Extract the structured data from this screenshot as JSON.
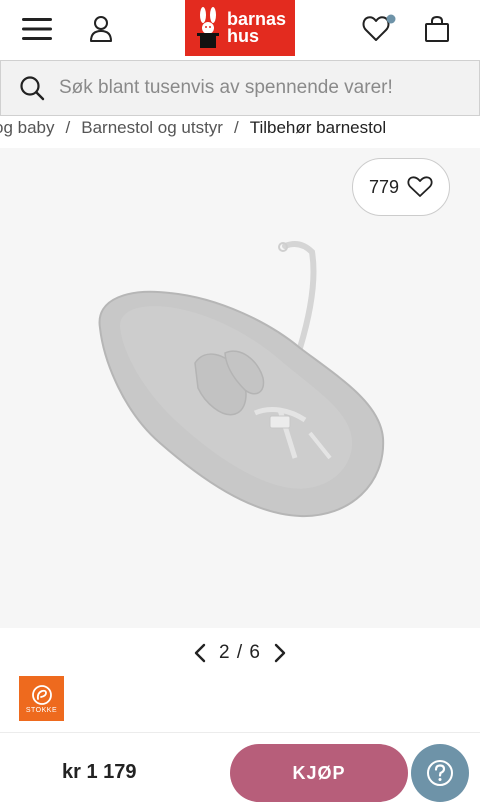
{
  "header": {
    "logo_line1": "barnas",
    "logo_line2": "hus",
    "brand_color": "#e32b1f",
    "icons": [
      "menu-icon",
      "account-icon",
      "wishlist-icon",
      "cart-icon"
    ],
    "wishlist_dot_color": "#6e93a8"
  },
  "search": {
    "placeholder": "Søk blant tusenvis av spennende varer!"
  },
  "breadcrumb": {
    "items": [
      "og baby",
      "Barnestol og utstyr",
      "Tilbehør barnestol"
    ],
    "separator": "/"
  },
  "product": {
    "favorites_count": "779",
    "image_index": "2 / 6",
    "brand_name": "STOKKE",
    "brand_color": "#ee6a1e"
  },
  "purchase": {
    "price": "kr 1 179",
    "buy_label": "KJØP",
    "buy_color": "#b75e7a",
    "help_color": "#6e93a8"
  }
}
